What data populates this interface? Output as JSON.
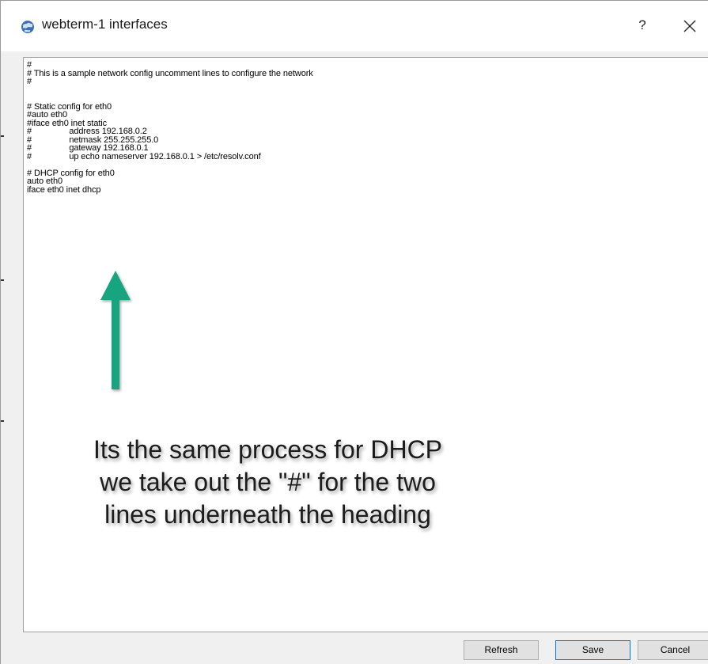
{
  "window": {
    "title": "webterm-1 interfaces",
    "help_label": "?",
    "icons": {
      "app": "app-globe-icon",
      "close": "close-icon"
    }
  },
  "editor": {
    "lines": [
      "#",
      "# This is a sample network config uncomment lines to configure the network",
      "#",
      "",
      "",
      "# Static config for eth0",
      "#auto eth0",
      "#iface eth0 inet static",
      "#                address 192.168.0.2",
      "#                netmask 255.255.255.0",
      "#                gateway 192.168.0.1",
      "#                up echo nameserver 192.168.0.1 > /etc/resolv.conf",
      "",
      "# DHCP config for eth0",
      "auto eth0",
      "iface eth0 inet dhcp"
    ]
  },
  "annotation": {
    "lines": [
      "Its the same process for DHCP",
      "we take out the \"#\" for the two",
      "lines underneath the heading"
    ],
    "arrow_color": "#17a57f"
  },
  "footer": {
    "refresh_label": "Refresh",
    "save_label": "Save",
    "cancel_label": "Cancel"
  }
}
